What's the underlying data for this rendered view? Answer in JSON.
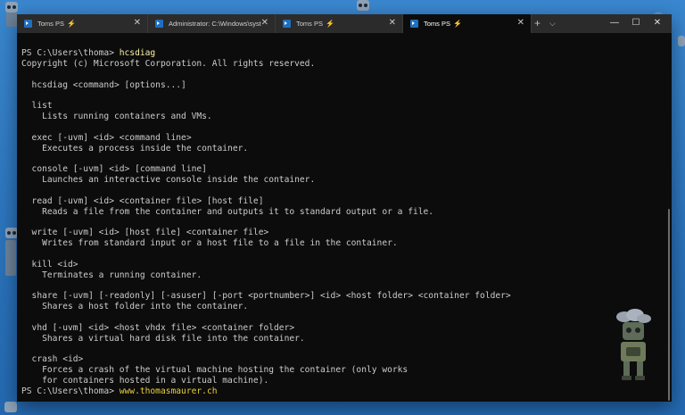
{
  "tabs": [
    {
      "title": "Toms PS",
      "powerline": true,
      "active": false
    },
    {
      "title": "Administrator: C:\\Windows\\syst",
      "powerline": false,
      "active": false
    },
    {
      "title": "Toms PS",
      "powerline": true,
      "active": false
    },
    {
      "title": "Toms PS",
      "powerline": true,
      "active": true
    }
  ],
  "window_controls": {
    "new_tab": "+",
    "dropdown": "⌵",
    "minimize": "—",
    "maximize": "☐",
    "close": "✕"
  },
  "terminal": {
    "lines": [
      {
        "prefix": "PS C:\\Users\\thoma> ",
        "cmd": "hcsdiag"
      },
      {
        "text": "Copyright (c) Microsoft Corporation. All rights reserved."
      },
      {
        "text": ""
      },
      {
        "text": "  hcsdiag <command> [options...]"
      },
      {
        "text": ""
      },
      {
        "text": "  list"
      },
      {
        "text": "    Lists running containers and VMs."
      },
      {
        "text": ""
      },
      {
        "text": "  exec [-uvm] <id> <command line>"
      },
      {
        "text": "    Executes a process inside the container."
      },
      {
        "text": ""
      },
      {
        "text": "  console [-uvm] <id> [command line]"
      },
      {
        "text": "    Launches an interactive console inside the container."
      },
      {
        "text": ""
      },
      {
        "text": "  read [-uvm] <id> <container file> [host file]"
      },
      {
        "text": "    Reads a file from the container and outputs it to standard output or a file."
      },
      {
        "text": ""
      },
      {
        "text": "  write [-uvm] <id> [host file] <container file>"
      },
      {
        "text": "    Writes from standard input or a host file to a file in the container."
      },
      {
        "text": ""
      },
      {
        "text": "  kill <id>"
      },
      {
        "text": "    Terminates a running container."
      },
      {
        "text": ""
      },
      {
        "text": "  share [-uvm] [-readonly] [-asuser] [-port <portnumber>] <id> <host folder> <container folder>"
      },
      {
        "text": "    Shares a host folder into the container."
      },
      {
        "text": ""
      },
      {
        "text": "  vhd [-uvm] <id> <host vhdx file> <container folder>"
      },
      {
        "text": "    Shares a virtual hard disk file into the container."
      },
      {
        "text": ""
      },
      {
        "text": "  crash <id>"
      },
      {
        "text": "    Forces a crash of the virtual machine hosting the container (only works"
      },
      {
        "text": "    for containers hosted in a virtual machine)."
      },
      {
        "prefix": "PS C:\\Users\\thoma> ",
        "url": "www.thomasmaurer.ch"
      }
    ]
  },
  "colors": {
    "terminal_bg": "#0c0c0c",
    "terminal_fg": "#cccccc",
    "command": "#f9f1a5",
    "tab_bar": "#2b2b2b",
    "desktop": "#2a78c2"
  }
}
